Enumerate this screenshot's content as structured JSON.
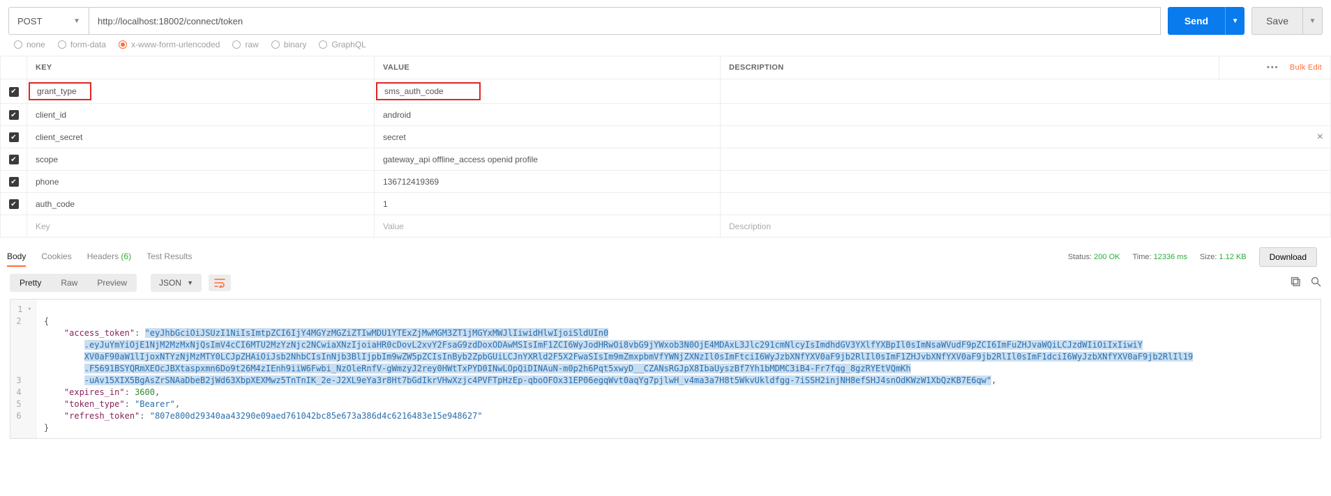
{
  "request": {
    "method": "POST",
    "url": "http://localhost:18002/connect/token",
    "send_label": "Send",
    "save_label": "Save"
  },
  "body_types": {
    "none": "none",
    "formdata": "form-data",
    "xwww": "x-www-form-urlencoded",
    "raw": "raw",
    "binary": "binary",
    "graphql": "GraphQL",
    "selected": "x-www-form-urlencoded"
  },
  "params": {
    "headers": {
      "key": "KEY",
      "value": "VALUE",
      "desc": "DESCRIPTION"
    },
    "actions": {
      "dots": "•••",
      "bulk_edit": "Bulk Edit"
    },
    "rows": [
      {
        "checked": true,
        "key": "grant_type",
        "value": "sms_auth_code",
        "highlight": true
      },
      {
        "checked": true,
        "key": "client_id",
        "value": "android"
      },
      {
        "checked": true,
        "key": "client_secret",
        "value": "secret",
        "drag": true,
        "close": true
      },
      {
        "checked": true,
        "key": "scope",
        "value": "gateway_api  offline_access openid profile"
      },
      {
        "checked": true,
        "key": "phone",
        "value": "136712419369"
      },
      {
        "checked": true,
        "key": "auth_code",
        "value": "1"
      }
    ],
    "placeholder": {
      "key": "Key",
      "value": "Value",
      "desc": "Description"
    }
  },
  "response": {
    "tabs": {
      "body": "Body",
      "cookies": "Cookies",
      "headers": "Headers",
      "headers_count": "(6)",
      "tests": "Test Results"
    },
    "status_label": "Status:",
    "status_value": "200 OK",
    "time_label": "Time:",
    "time_value": "12336 ms",
    "size_label": "Size:",
    "size_value": "1.12 KB",
    "download": "Download"
  },
  "viewer": {
    "pretty": "Pretty",
    "raw": "Raw",
    "preview": "Preview",
    "format": "JSON"
  },
  "json": {
    "keys": {
      "access_token": "\"access_token\"",
      "expires_in": "\"expires_in\"",
      "token_type": "\"token_type\"",
      "refresh_token": "\"refresh_token\""
    },
    "access_token_l1": "\"eyJhbGciOiJSUzI1NiIsImtpZCI6IjY4MGYzMGZiZTIwMDU1YTExZjMwMGM3ZT1jMGYxMWJlIiwidHlwIjoiSldUIn0",
    "access_token_l2": ".eyJuYmYiOjE1NjM2MzMxNjQsImV4cCI6MTU2MzYzNjc2NCwiaXNzIjoiaHR0cDovL2xvY2FsaG9zdDoxODAwMSIsImF1ZCI6WyJodHRwOi8vbG9jYWxob3N0OjE4MDAxL3Jlc291cmNlcyIsImdhdGV3YXlfYXBpIl0sImNsaWVudF9pZCI6ImFuZHJvaWQiLCJzdWIiOiIxIiwiY",
    "access_token_l3": "XV0aF90aW1lIjoxNTYzNjMzMTY0LCJpZHAiOiJsb2NhbCIsInNjb3BlIjpbIm9wZW5pZCIsInByb2ZpbGUiLCJnYXRld2F5X2FwaSIsIm9mZmxpbmVfYWNjZXNzIl0sImFtciI6WyJzbXNfYXV0aF9jb2RlIl0sImF1ZHJvbXNfYXV0aF9jb2RlIl0sImF1dciI6WyJzbXNfYXV0aF9jb2RlIl19",
    "access_token_l4": ".F5691BSYQRmXEOcJBXtaspxmn6Do9t26M4zIEnh9iiW6Fwbi_NzOleRnfV-gWmzyJ2rey0HWtTxPYD0INwLOpQiDINAuN-m0p2h6Pqt5xwyD__CZANsRGJpX8IbaUyszBf7Yh1bMDMC3iB4-Fr7fqg_8gzRYEtVQmKh",
    "access_token_l5": "-uAv15XIX5BgAsZrSNAaDbeB2jWd63XbpXEXMwz5TnTnIK_2e-J2XL9eYa3r8Ht7bGdIkrVHwXzjc4PVFTpHzEp-qboOFOx31EP06egqWvt0aqYg7pjlwH_v4ma3a7H8t5WkvUkldfgg-7iSSH2injNH8efSHJ4snOdKWzW1XbQzKB7E6qw\"",
    "expires_in": "3600",
    "token_type": "\"Bearer\"",
    "refresh_token": "\"807e800d29340aa43290e09aed761042bc85e673a386d4c6216483e15e948627\""
  }
}
